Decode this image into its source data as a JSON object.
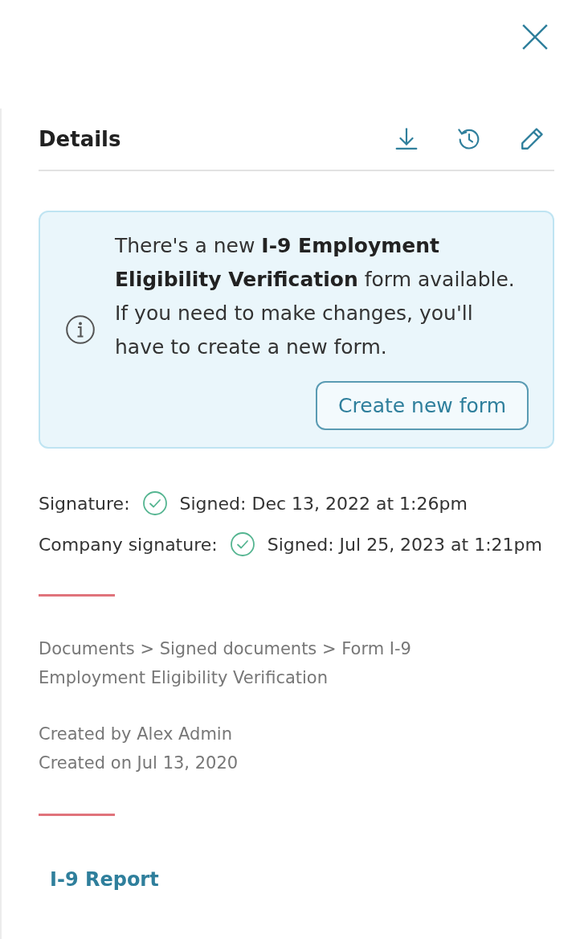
{
  "header": {
    "title": "Details"
  },
  "notice": {
    "text": "There's a new **I-9 Employment Eligibility Verification** form available. If you need to make changes, you'll have to create a new form.",
    "button": "Create new form"
  },
  "signatures": [
    {
      "label": "Signature:",
      "signed": true,
      "status": "Signed: Dec 13, 2022 at 1:26pm"
    },
    {
      "label": "Company signature:",
      "signed": true,
      "status": "Signed: Jul 25, 2023 at 1:21pm"
    }
  ],
  "location": "Documents > Signed documents > Form I-9 Employment Eligibility Verification",
  "created_by": "Created by Alex Admin",
  "created_on": "Created on Jul 13, 2020",
  "report_link": "I-9 Report"
}
